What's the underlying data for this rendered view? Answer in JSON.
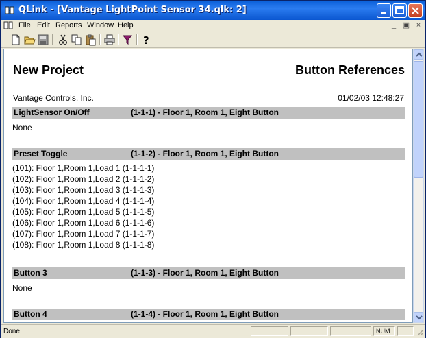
{
  "window": {
    "title": "QLink - [Vantage LightPoint Sensor 34.qlk: 2]",
    "accent": "#0a5fd8"
  },
  "menu": {
    "items": [
      "File",
      "Edit",
      "Reports",
      "Window",
      "Help"
    ]
  },
  "toolbar": {
    "icons": [
      "new-document-icon",
      "open-folder-icon",
      "save-icon",
      "cut-icon",
      "copy-icon",
      "paste-icon",
      "print-icon",
      "filter-icon",
      "help-icon"
    ]
  },
  "report": {
    "project_title": "New Project",
    "report_title": "Button References",
    "company": "Vantage Controls, Inc.",
    "timestamp": "01/02/03 12:48:27",
    "sections": [
      {
        "name": "LightSensor On/Off",
        "ref": "(1-1-1) - Floor 1, Room 1, Eight Button",
        "lines": [
          "None"
        ]
      },
      {
        "name": "Preset Toggle",
        "ref": "(1-1-2) - Floor 1, Room 1, Eight Button",
        "lines": [
          "(101): Floor 1,Room 1,Load 1 (1-1-1-1)",
          "(102): Floor 1,Room 1,Load 2 (1-1-1-2)",
          "(103): Floor 1,Room 1,Load 3 (1-1-1-3)",
          "(104): Floor 1,Room 1,Load 4 (1-1-1-4)",
          "(105): Floor 1,Room 1,Load 5 (1-1-1-5)",
          "(106): Floor 1,Room 1,Load 6 (1-1-1-6)",
          "(107): Floor 1,Room 1,Load 7 (1-1-1-7)",
          "(108): Floor 1,Room 1,Load 8 (1-1-1-8)"
        ]
      },
      {
        "name": "Button 3",
        "ref": "(1-1-3) - Floor 1, Room 1, Eight Button",
        "lines": [
          "None"
        ]
      },
      {
        "name": "Button 4",
        "ref": "(1-1-4) - Floor 1, Room 1, Eight Button",
        "lines": []
      }
    ],
    "section_bg": "#c0c0c0"
  },
  "status": {
    "text": "Done",
    "num": "NUM"
  }
}
